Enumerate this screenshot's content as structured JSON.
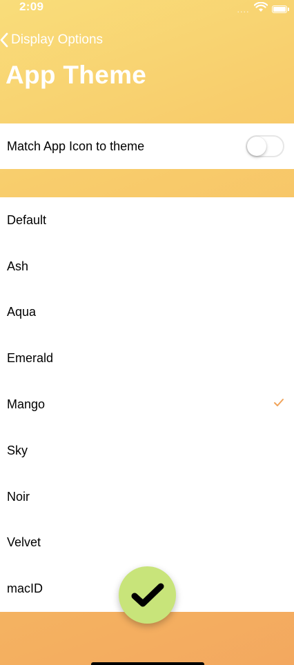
{
  "status_bar": {
    "time": "2:09",
    "signal": "...."
  },
  "nav": {
    "back_label": "Display Options",
    "title": "App Theme"
  },
  "settings": {
    "match_icon_label": "Match App Icon to theme",
    "match_icon_on": false
  },
  "themes": {
    "selected": "Mango",
    "items": [
      {
        "label": "Default"
      },
      {
        "label": "Ash"
      },
      {
        "label": "Aqua"
      },
      {
        "label": "Emerald"
      },
      {
        "label": "Mango"
      },
      {
        "label": "Sky"
      },
      {
        "label": "Noir"
      },
      {
        "label": "Velvet"
      },
      {
        "label": "macID"
      }
    ]
  },
  "colors": {
    "accent": "#f0a35a",
    "fab_background": "#c8e47a",
    "header_gradient_start": "#f9dd7a",
    "header_gradient_end": "#f3a85f"
  },
  "icons": {
    "back": "chevron-left-icon",
    "selected_mark": "checkmark-icon",
    "fab": "checkmark-icon",
    "wifi": "wifi-icon",
    "battery": "battery-icon"
  }
}
